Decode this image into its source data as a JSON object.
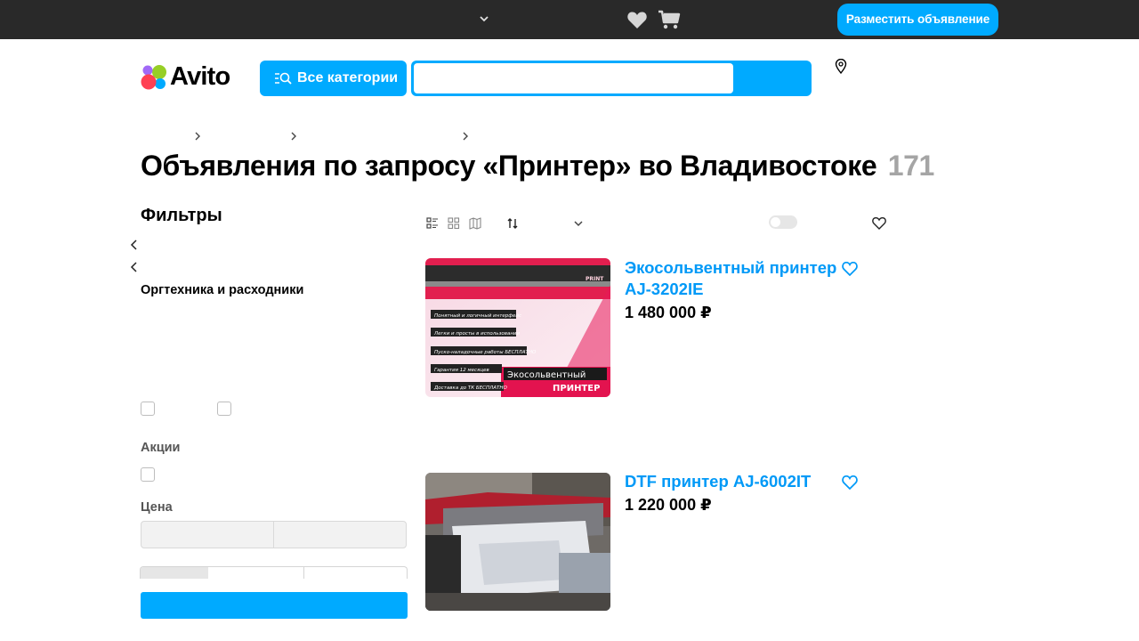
{
  "topbar": {
    "post_button": "Разместить объявление",
    "icons": [
      "chevron-down-icon",
      "heart-icon",
      "cart-icon"
    ]
  },
  "header": {
    "logo_text": "Avito",
    "categories_button": "Все категории",
    "search": {
      "value": "",
      "placeholder": ""
    },
    "icons": [
      "location-pin-icon"
    ]
  },
  "page": {
    "title": "Объявления по запросу «Принтер» во Владивостоке",
    "count": "171"
  },
  "filters": {
    "heading": "Фильтры",
    "category": "Оргтехника и расходники",
    "promo_heading": "Акции",
    "price_heading": "Цена"
  },
  "listings": [
    {
      "title": "Экосольвентный принтер AJ-3202IE",
      "price": "1 480 000 ₽",
      "image_text": {
        "brand": "PRINT",
        "lines": [
          "Понятный и логичный интерфейс",
          "Легки и просты в использовании",
          "Пуско-наладочные работы БЕСПЛАТНО",
          "Гарантия 12 месяцев",
          "Доставка до ТК БЕСПЛАТНО"
        ],
        "banner_top": "Экосольвентный",
        "banner_bottom": "ПРИНТЕР"
      }
    },
    {
      "title": "DTF принтер AJ-6002IT",
      "price": "1 220 000 ₽"
    }
  ],
  "colors": {
    "accent": "#00aaff",
    "link": "#0099f7",
    "topbar": "#292929",
    "muted_count": "#a5a5a5"
  }
}
